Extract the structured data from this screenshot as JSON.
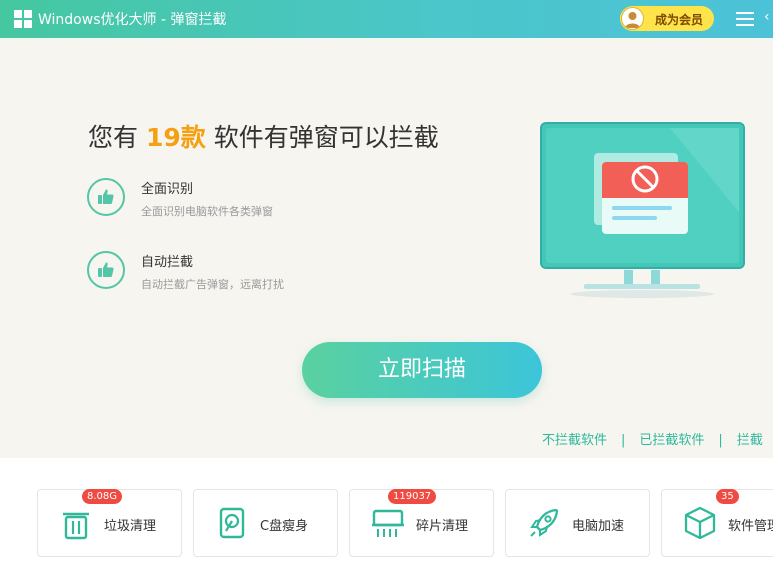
{
  "window": {
    "title": "Windows优化大师 - 弹窗拦截"
  },
  "header": {
    "vip_label": "成为会员"
  },
  "main": {
    "headline_prefix": "您有 ",
    "headline_count": "19款",
    "headline_suffix": " 软件有弹窗可以拦截",
    "features": [
      {
        "title": "全面识别",
        "desc": "全面识别电脑软件各类弹窗"
      },
      {
        "title": "自动拦截",
        "desc": "自动拦截广告弹窗，远离打扰"
      }
    ],
    "scan_label": "立即扫描",
    "links": [
      "不拦截软件",
      "已拦截软件",
      "拦截"
    ],
    "link_separator": "|"
  },
  "tools": [
    {
      "label": "垃圾清理",
      "badge": "8.08G",
      "icon": "trash-icon"
    },
    {
      "label": "C盘瘦身",
      "badge": "",
      "icon": "disk-icon"
    },
    {
      "label": "碎片清理",
      "badge": "119037",
      "icon": "shredder-icon"
    },
    {
      "label": "电脑加速",
      "badge": "",
      "icon": "rocket-icon"
    },
    {
      "label": "软件管理",
      "badge": "35",
      "icon": "box-icon"
    }
  ],
  "colors": {
    "accent": "#45c7a0",
    "badge": "#f04b42",
    "highlight": "#f5a012",
    "vip": "#ffe34a"
  }
}
